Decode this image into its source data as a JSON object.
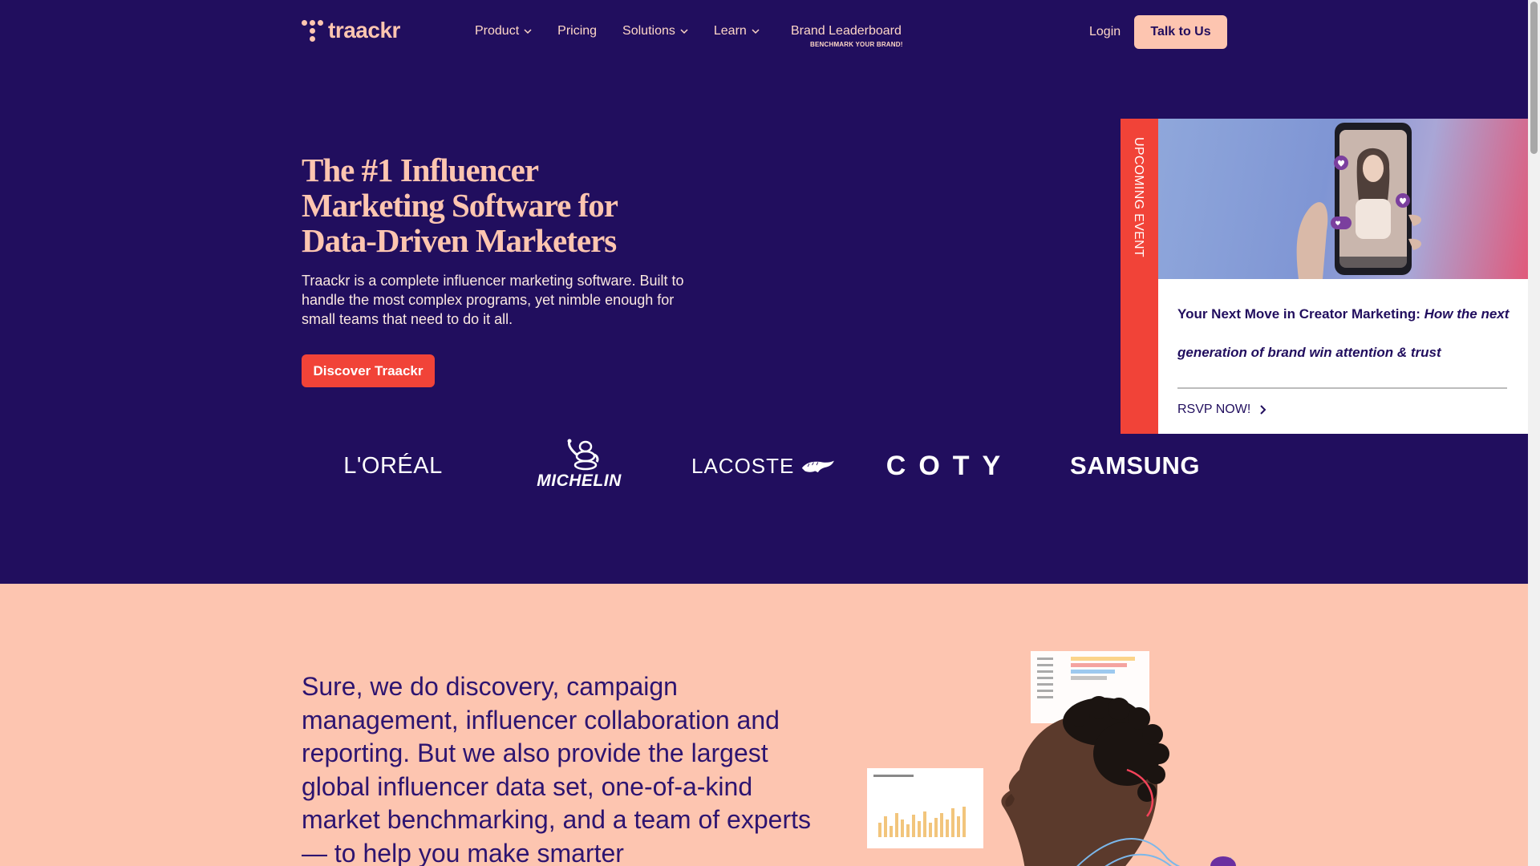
{
  "nav": {
    "logo_text": "traackr",
    "items": [
      {
        "label": "Product",
        "has_dropdown": true
      },
      {
        "label": "Pricing",
        "has_dropdown": false
      },
      {
        "label": "Solutions",
        "has_dropdown": true
      },
      {
        "label": "Learn",
        "has_dropdown": true
      }
    ],
    "leaderboard": {
      "label": "Brand Leaderboard",
      "sublabel": "BENCHMARK YOUR BRAND!"
    },
    "login": "Login",
    "cta": "Talk to Us"
  },
  "hero": {
    "headline": "The #1 Influencer Marketing Software for Data-Driven Marketers",
    "subtext": "Traackr is a complete influencer marketing software. Built to handle the most complex programs, yet nimble enough for small teams that need to do it all.",
    "cta": "Discover Traackr"
  },
  "brands": {
    "loreal": "L'ORÉAL",
    "michelin": "MICHELIN",
    "lacoste": "LACOSTE",
    "coty": "COTY",
    "samsung": "SAMSUNG"
  },
  "event": {
    "strip_label": "UPCOMING EVENT",
    "title_bold": "Your Next Move in Creator Marketing: ",
    "title_italic": "How the next generation of brand win attention & trust",
    "rsvp": "RSVP NOW!"
  },
  "lower": {
    "text": "Sure, we do discovery, campaign management, influencer collaboration and reporting. But we also provide the largest global influencer data set, one-of-a-kind market benchmarking, and a team of experts — to help you make smarter"
  },
  "colors": {
    "navy": "#210e5e",
    "peach": "#fdc5b0",
    "coral": "#f14338"
  },
  "icons": {
    "chevron": "chevron-down-icon",
    "rsvp_arrow": "chevron-right-icon"
  }
}
